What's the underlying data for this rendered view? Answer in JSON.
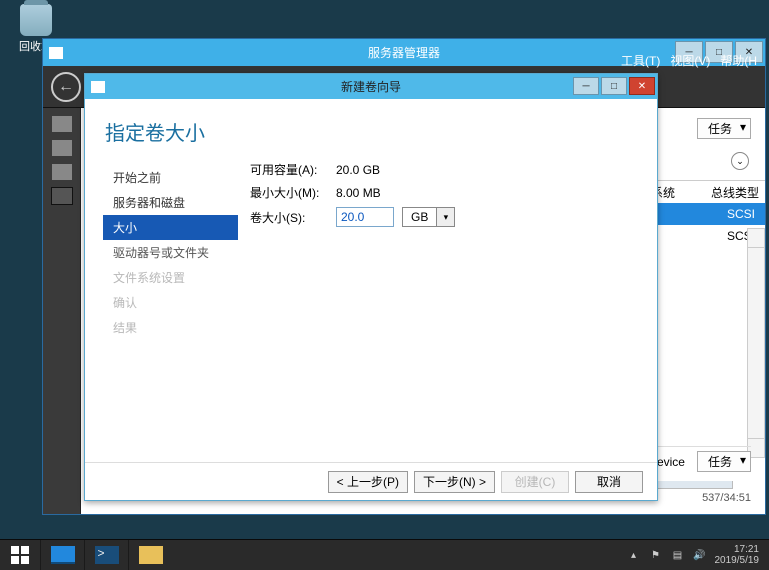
{
  "desktop": {
    "recycle_label": "回收站"
  },
  "server_manager": {
    "title": "服务器管理器",
    "menu": {
      "tools": "工具(T)",
      "view": "视图(V)",
      "help": "帮助(H"
    },
    "tasks_dropdown": "任务",
    "column": {
      "system": "系统",
      "bus_type": "总线类型"
    },
    "rows": [
      {
        "bus": "SCSI",
        "selected": true
      },
      {
        "bus": "SCSI",
        "selected": false
      }
    ],
    "bottom": {
      "device_label": "evice",
      "tasks": "任务"
    },
    "corrupt_date": "537/34:51"
  },
  "wizard": {
    "title": "新建卷向导",
    "heading": "指定卷大小",
    "nav": {
      "before": "开始之前",
      "server_disk": "服务器和磁盘",
      "size": "大小",
      "drive": "驱动器号或文件夹",
      "fs": "文件系统设置",
      "confirm": "确认",
      "result": "结果"
    },
    "fields": {
      "avail_label": "可用容量(A):",
      "avail_value": "20.0 GB",
      "min_label": "最小大小(M):",
      "min_value": "8.00 MB",
      "size_label": "卷大小(S):",
      "size_value": "20.0",
      "unit": "GB"
    },
    "buttons": {
      "prev": "< 上一步(P)",
      "next": "下一步(N) >",
      "create": "创建(C)",
      "cancel": "取消"
    }
  },
  "taskbar": {
    "time": "17:21",
    "date": "2019/5/19"
  }
}
